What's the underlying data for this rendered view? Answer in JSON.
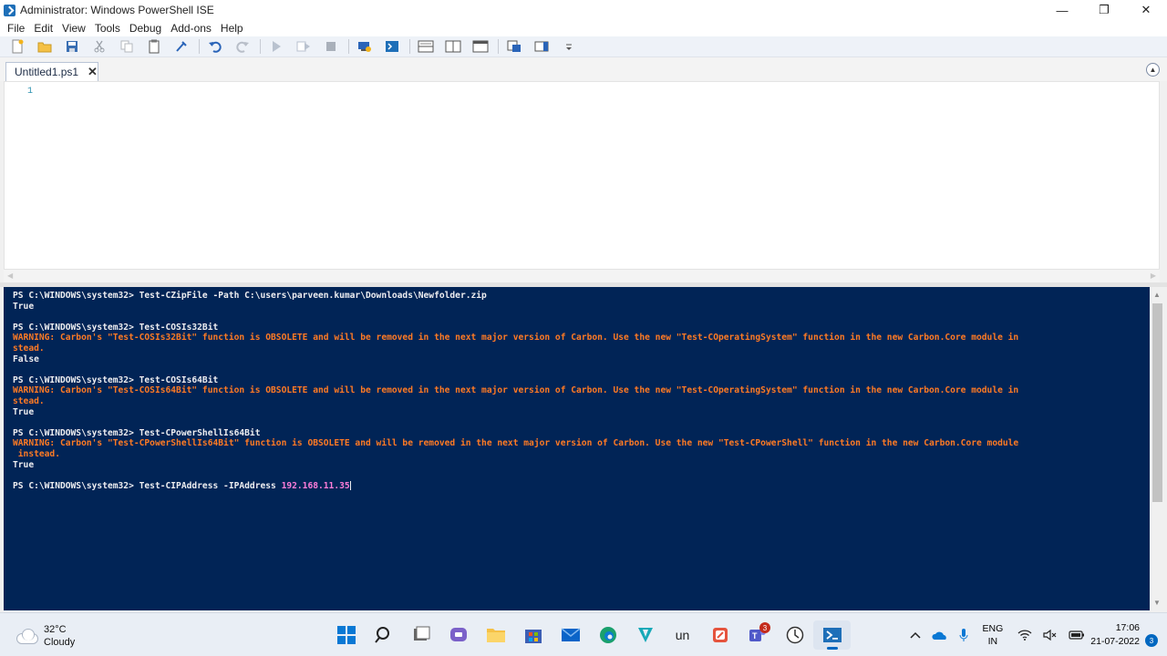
{
  "window": {
    "title": "Administrator: Windows PowerShell ISE",
    "minimize_glyph": "—",
    "restore_glyph": "❐",
    "close_glyph": "✕"
  },
  "menu": [
    "File",
    "Edit",
    "View",
    "Tools",
    "Debug",
    "Add-ons",
    "Help"
  ],
  "toolbar": {
    "buttons": [
      "new-script",
      "open",
      "save",
      "cut",
      "copy",
      "paste",
      "clear-console",
      "undo",
      "redo",
      "run-script",
      "run-selection",
      "stop",
      "new-remote-tab",
      "start-powershell",
      "show-script-top",
      "show-script-right",
      "show-script-maximized",
      "show-command-window",
      "show-command-addon"
    ]
  },
  "tabs": [
    {
      "label": "Untitled1.ps1",
      "close": "✕"
    }
  ],
  "editor": {
    "line_numbers": [
      "1"
    ]
  },
  "console": {
    "lines": [
      [
        {
          "t": "PS C:\\WINDOWS\\system32> Test-CZipFile -Path C:\\users\\parveen.kumar\\Downloads\\Newfolder.zip",
          "c": "n"
        }
      ],
      [
        {
          "t": "True",
          "c": "n"
        }
      ],
      [
        {
          "t": "",
          "c": "n"
        }
      ],
      [
        {
          "t": "PS C:\\WINDOWS\\system32> Test-COSIs32Bit",
          "c": "n"
        }
      ],
      [
        {
          "t": "WARNING: Carbon's \"Test-COSIs32Bit\" function is OBSOLETE and will be removed in the next major version of Carbon. Use the new \"Test-COperatingSystem\" function in the new Carbon.Core module in",
          "c": "w"
        }
      ],
      [
        {
          "t": "stead.",
          "c": "w"
        }
      ],
      [
        {
          "t": "False",
          "c": "n"
        }
      ],
      [
        {
          "t": "",
          "c": "n"
        }
      ],
      [
        {
          "t": "PS C:\\WINDOWS\\system32> Test-COSIs64Bit",
          "c": "n"
        }
      ],
      [
        {
          "t": "WARNING: Carbon's \"Test-COSIs64Bit\" function is OBSOLETE and will be removed in the next major version of Carbon. Use the new \"Test-COperatingSystem\" function in the new Carbon.Core module in",
          "c": "w"
        }
      ],
      [
        {
          "t": "stead.",
          "c": "w"
        }
      ],
      [
        {
          "t": "True",
          "c": "n"
        }
      ],
      [
        {
          "t": "",
          "c": "n"
        }
      ],
      [
        {
          "t": "PS C:\\WINDOWS\\system32> Test-CPowerShellIs64Bit",
          "c": "n"
        }
      ],
      [
        {
          "t": "WARNING: Carbon's \"Test-CPowerShellIs64Bit\" function is OBSOLETE and will be removed in the next major version of Carbon. Use the new \"Test-CPowerShell\" function in the new Carbon.Core module",
          "c": "w"
        }
      ],
      [
        {
          "t": " instead.",
          "c": "w"
        }
      ],
      [
        {
          "t": "True",
          "c": "n"
        }
      ],
      [
        {
          "t": "",
          "c": "n"
        }
      ],
      [
        {
          "t": "PS C:\\WINDOWS\\system32> Test-CIPAddress -IPAddress ",
          "c": "n"
        },
        {
          "t": "192.168.11.35",
          "c": "a"
        }
      ]
    ]
  },
  "taskbar": {
    "weather_temp": "32°C",
    "weather_desc": "Cloudy",
    "apps": [
      "windows-start",
      "search",
      "task-view",
      "chat",
      "file-explorer",
      "microsoft-store",
      "mail",
      "edge",
      "vpn",
      "un",
      "paint",
      "teams",
      "clock-app",
      "powershell-ise"
    ],
    "un_label": "un",
    "teams_badge": "3",
    "lang_line1": "ENG",
    "lang_line2": "IN",
    "time": "17:06",
    "date": "21-07-2022",
    "notification_count": "3"
  },
  "colors": {
    "console_bg": "#012456",
    "console_text": "#eeedf0",
    "warning": "#ff7a24",
    "argument": "#ff7dd9"
  }
}
